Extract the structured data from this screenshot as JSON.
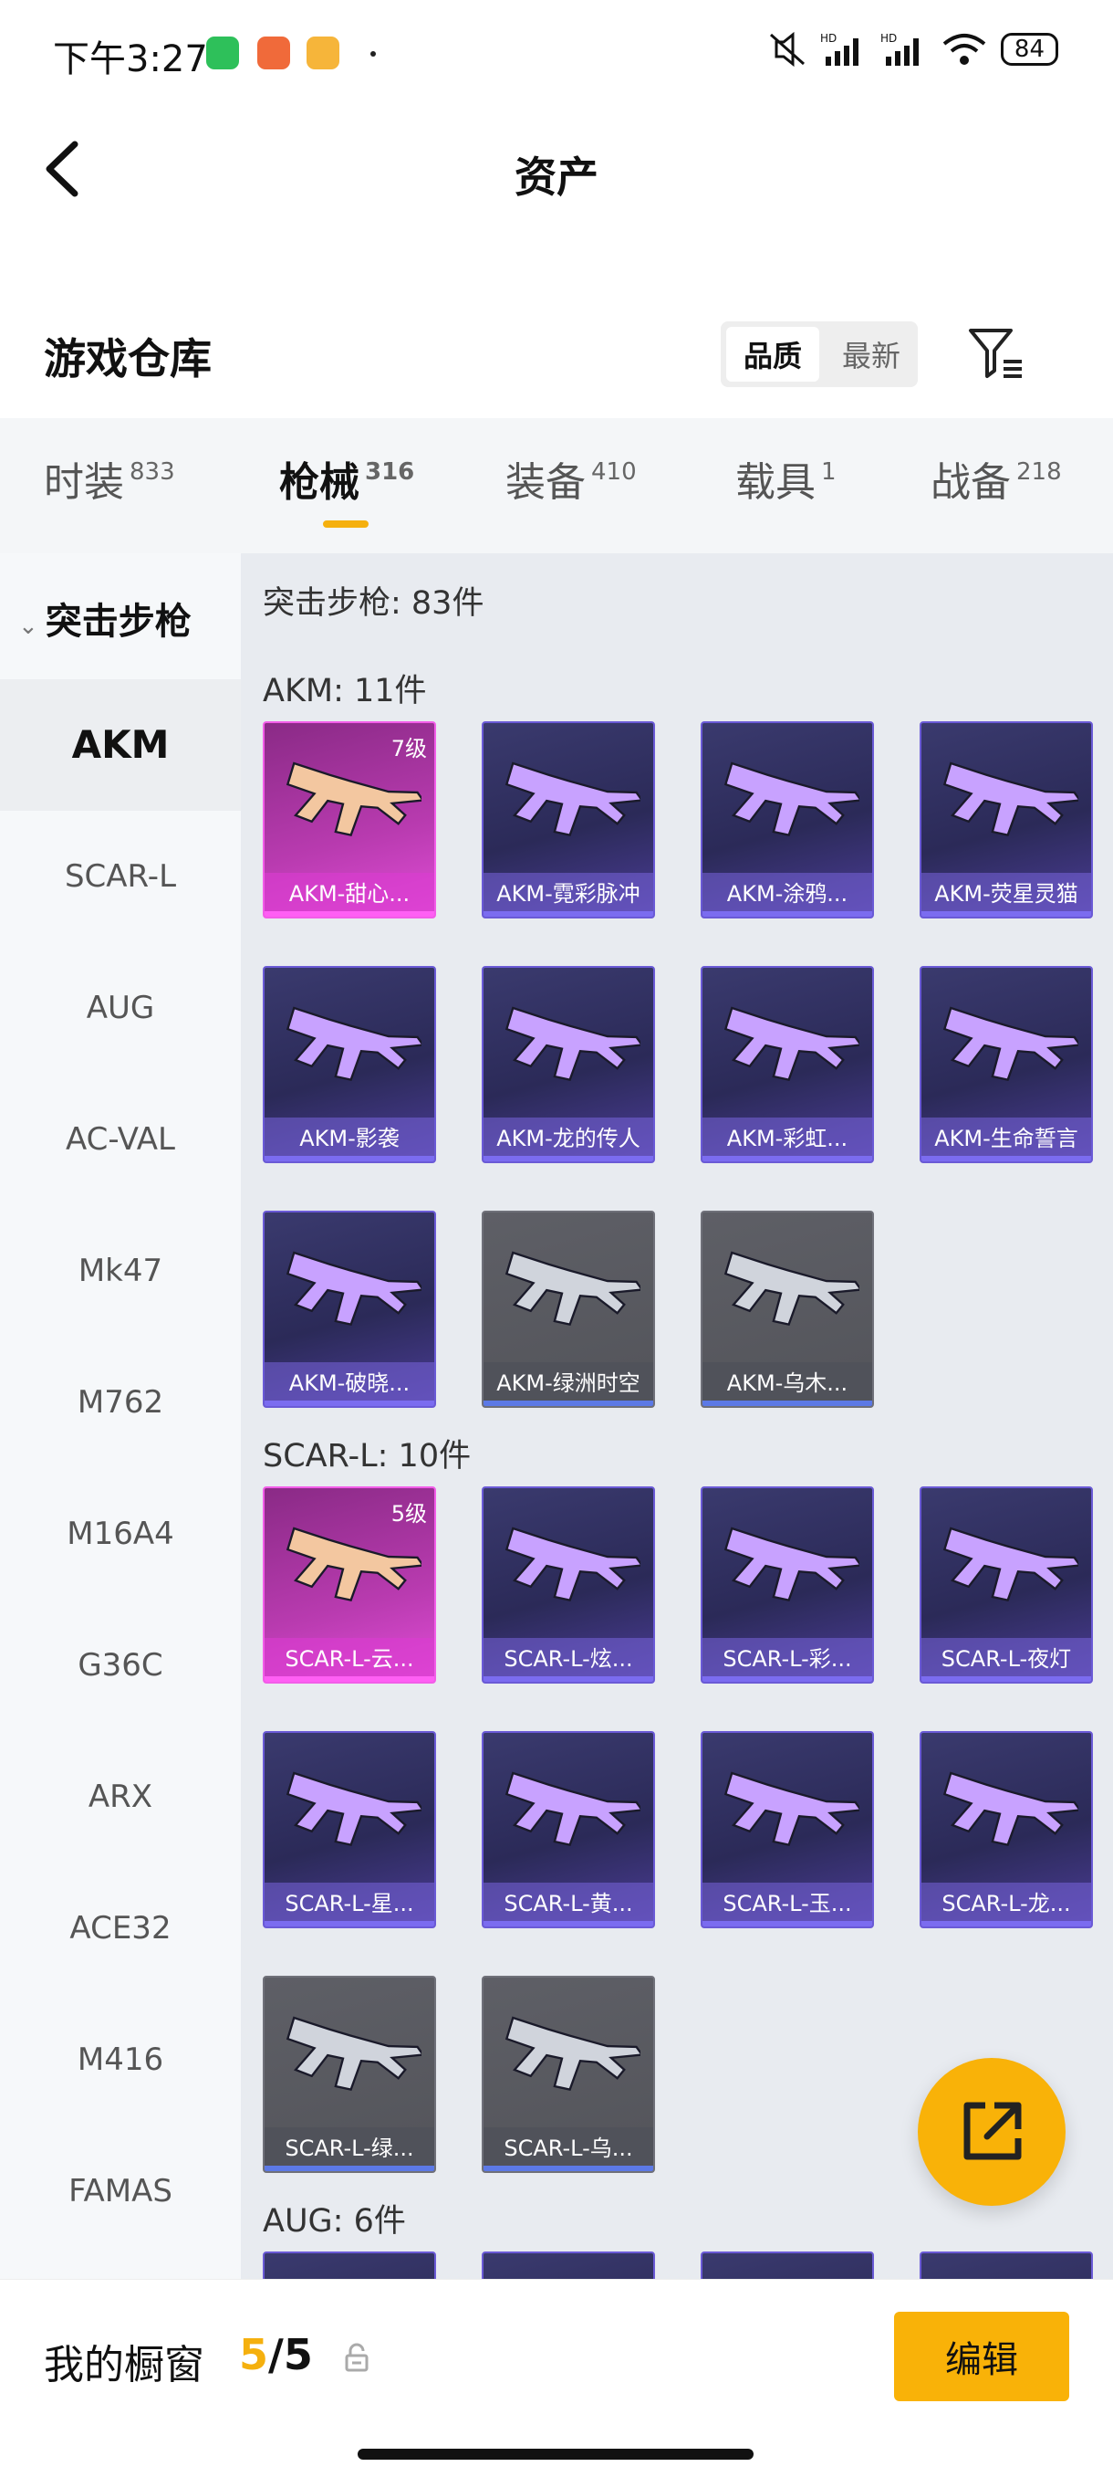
{
  "status_bar": {
    "time": "下午3:27",
    "battery": "84",
    "icons": [
      "wechat-icon",
      "app-red-icon",
      "app-yellow-icon",
      "mute-icon",
      "signal-hd-icon",
      "signal-hd-icon",
      "wifi-icon",
      "battery-icon"
    ]
  },
  "header": {
    "title": "资产",
    "back_icon": "back-arrow-icon"
  },
  "section": {
    "title": "游戏仓库",
    "sort_options": [
      "品质",
      "最新"
    ],
    "sort_selected": "品质",
    "filter_icon": "filter-icon"
  },
  "tabs": [
    {
      "label": "时装",
      "count": "833"
    },
    {
      "label": "枪械",
      "count": "316"
    },
    {
      "label": "装备",
      "count": "410"
    },
    {
      "label": "载具",
      "count": "1"
    },
    {
      "label": "战备",
      "count": "218"
    }
  ],
  "sidebar": {
    "category": "突击步枪",
    "items": [
      "AKM",
      "SCAR-L",
      "AUG",
      "AC-VAL",
      "Mk47",
      "M762",
      "M16A4",
      "G36C",
      "ARX",
      "ACE32",
      "M416",
      "FAMAS"
    ],
    "active": "AKM"
  },
  "content": {
    "summary": "突击步枪: 83件",
    "groups": [
      {
        "label": "AKM: 11件",
        "items": [
          {
            "name": "AKM-甜心...",
            "style": "pink",
            "level": "7级"
          },
          {
            "name": "AKM-霓彩脉冲",
            "style": "purple"
          },
          {
            "name": "AKM-涂鸦...",
            "style": "purple"
          },
          {
            "name": "AKM-荧星灵猫",
            "style": "purple"
          },
          {
            "name": "AKM-影袭",
            "style": "purple"
          },
          {
            "name": "AKM-龙的传人",
            "style": "purple"
          },
          {
            "name": "AKM-彩虹...",
            "style": "purple"
          },
          {
            "name": "AKM-生命誓言",
            "style": "purple"
          },
          {
            "name": "AKM-破晓...",
            "style": "purple"
          },
          {
            "name": "AKM-绿洲时空",
            "style": "gray"
          },
          {
            "name": "AKM-乌木...",
            "style": "gray"
          }
        ]
      },
      {
        "label": "SCAR-L: 10件",
        "items": [
          {
            "name": "SCAR-L-云...",
            "style": "pink",
            "level": "5级"
          },
          {
            "name": "SCAR-L-炫...",
            "style": "purple"
          },
          {
            "name": "SCAR-L-彩...",
            "style": "purple"
          },
          {
            "name": "SCAR-L-夜灯",
            "style": "purple"
          },
          {
            "name": "SCAR-L-星...",
            "style": "purple"
          },
          {
            "name": "SCAR-L-黄...",
            "style": "purple"
          },
          {
            "name": "SCAR-L-玉...",
            "style": "purple"
          },
          {
            "name": "SCAR-L-龙...",
            "style": "purple"
          },
          {
            "name": "SCAR-L-绿...",
            "style": "gray"
          },
          {
            "name": "SCAR-L-乌...",
            "style": "gray"
          }
        ]
      },
      {
        "label": "AUG: 6件",
        "items": []
      }
    ]
  },
  "fab": {
    "icon": "share-export-icon"
  },
  "bottom_bar": {
    "label": "我的橱窗",
    "count_current": "5",
    "count_total": "/5",
    "lock_icon": "lock-icon",
    "edit_label": "编辑"
  },
  "colors": {
    "accent": "#f9b208",
    "sidebar_bg": "#f6f8fa",
    "content_bg": "#e8ebf0"
  }
}
